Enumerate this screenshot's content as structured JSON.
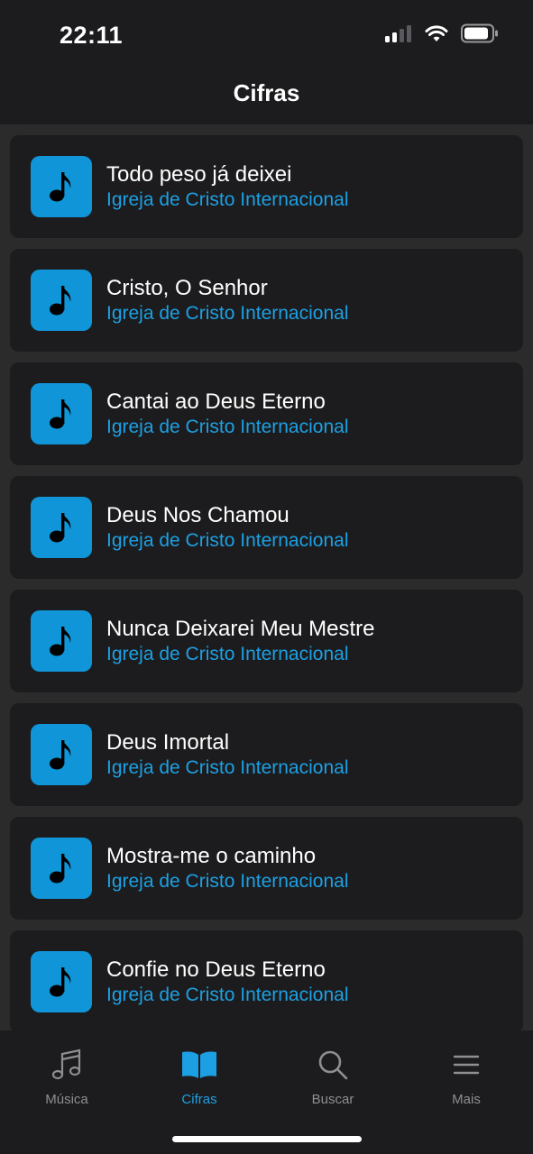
{
  "status_bar": {
    "time": "22:11"
  },
  "header": {
    "title": "Cifras"
  },
  "songs": [
    {
      "title": "Todo peso já deixei",
      "artist": "Igreja de Cristo Internacional"
    },
    {
      "title": "Cristo, O Senhor",
      "artist": "Igreja de Cristo Internacional"
    },
    {
      "title": "Cantai ao Deus Eterno",
      "artist": "Igreja de Cristo Internacional"
    },
    {
      "title": "Deus Nos Chamou",
      "artist": "Igreja de Cristo Internacional"
    },
    {
      "title": "Nunca Deixarei Meu Mestre",
      "artist": "Igreja de Cristo Internacional"
    },
    {
      "title": "Deus Imortal",
      "artist": "Igreja de Cristo Internacional"
    },
    {
      "title": "Mostra-me o caminho",
      "artist": "Igreja de Cristo Internacional"
    },
    {
      "title": "Confie no Deus Eterno",
      "artist": "Igreja de Cristo Internacional"
    }
  ],
  "tabbar": {
    "tabs": [
      {
        "label": "Música",
        "icon": "music-note-icon",
        "active": false
      },
      {
        "label": "Cifras",
        "icon": "book-icon",
        "active": true
      },
      {
        "label": "Buscar",
        "icon": "search-icon",
        "active": false
      },
      {
        "label": "Mais",
        "icon": "menu-icon",
        "active": false
      }
    ]
  },
  "colors": {
    "accent": "#1ca0e3",
    "icon_tile": "#1096d8",
    "card_bg": "#1c1c1e",
    "page_bg": "#2b2b2b",
    "inactive_tab": "#8e8e93"
  }
}
